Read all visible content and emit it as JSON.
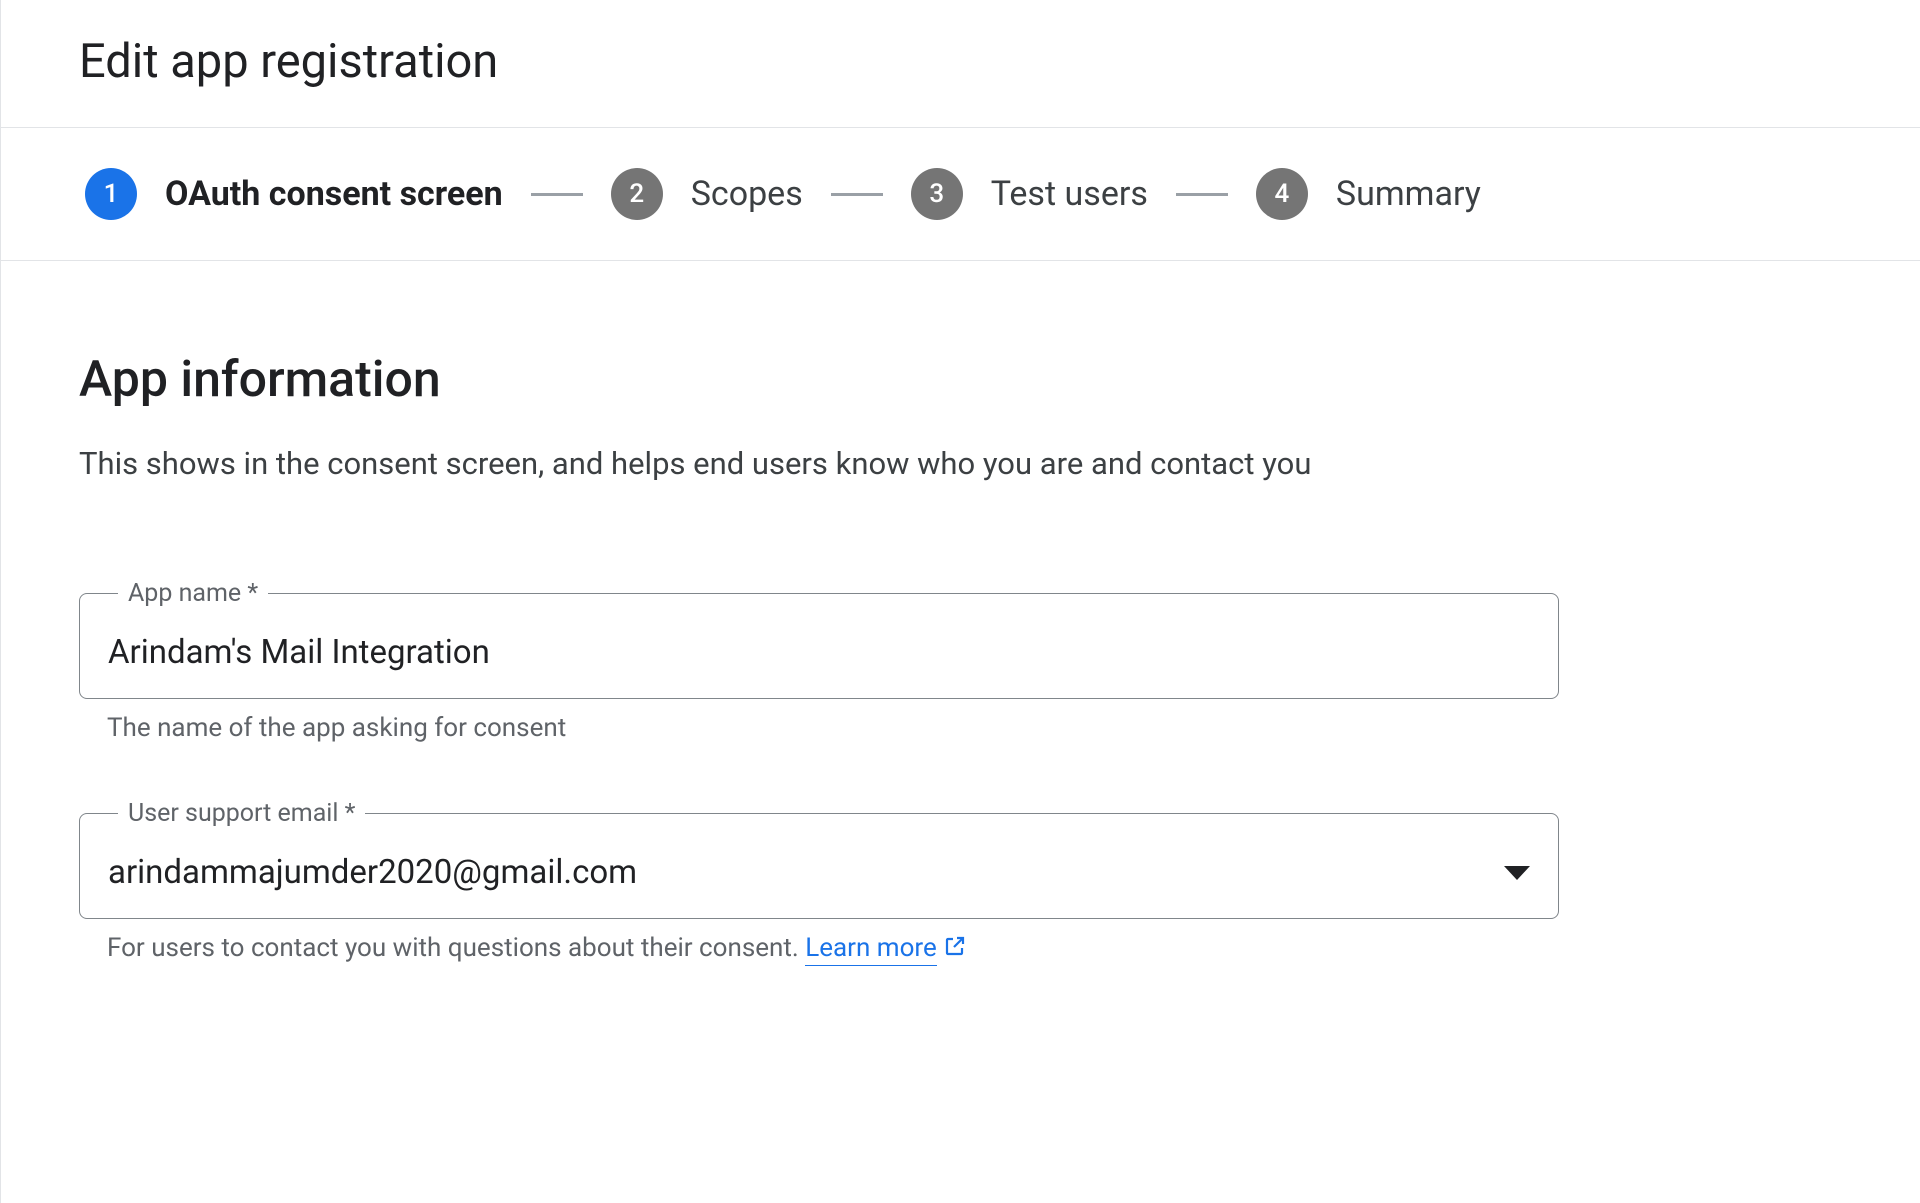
{
  "page_title": "Edit app registration",
  "stepper": {
    "steps": [
      {
        "num": "1",
        "label": "OAuth consent screen",
        "active": true
      },
      {
        "num": "2",
        "label": "Scopes",
        "active": false
      },
      {
        "num": "3",
        "label": "Test users",
        "active": false
      },
      {
        "num": "4",
        "label": "Summary",
        "active": false
      }
    ]
  },
  "section": {
    "title": "App information",
    "description": "This shows in the consent screen, and helps end users know who you are and contact you"
  },
  "fields": {
    "app_name": {
      "label": "App name *",
      "value": "Arindam's Mail Integration",
      "helper": "The name of the app asking for consent"
    },
    "support_email": {
      "label": "User support email *",
      "value": "arindammajumder2020@gmail.com",
      "helper_prefix": "For users to contact you with questions about their consent. ",
      "learn_more": "Learn more"
    }
  }
}
